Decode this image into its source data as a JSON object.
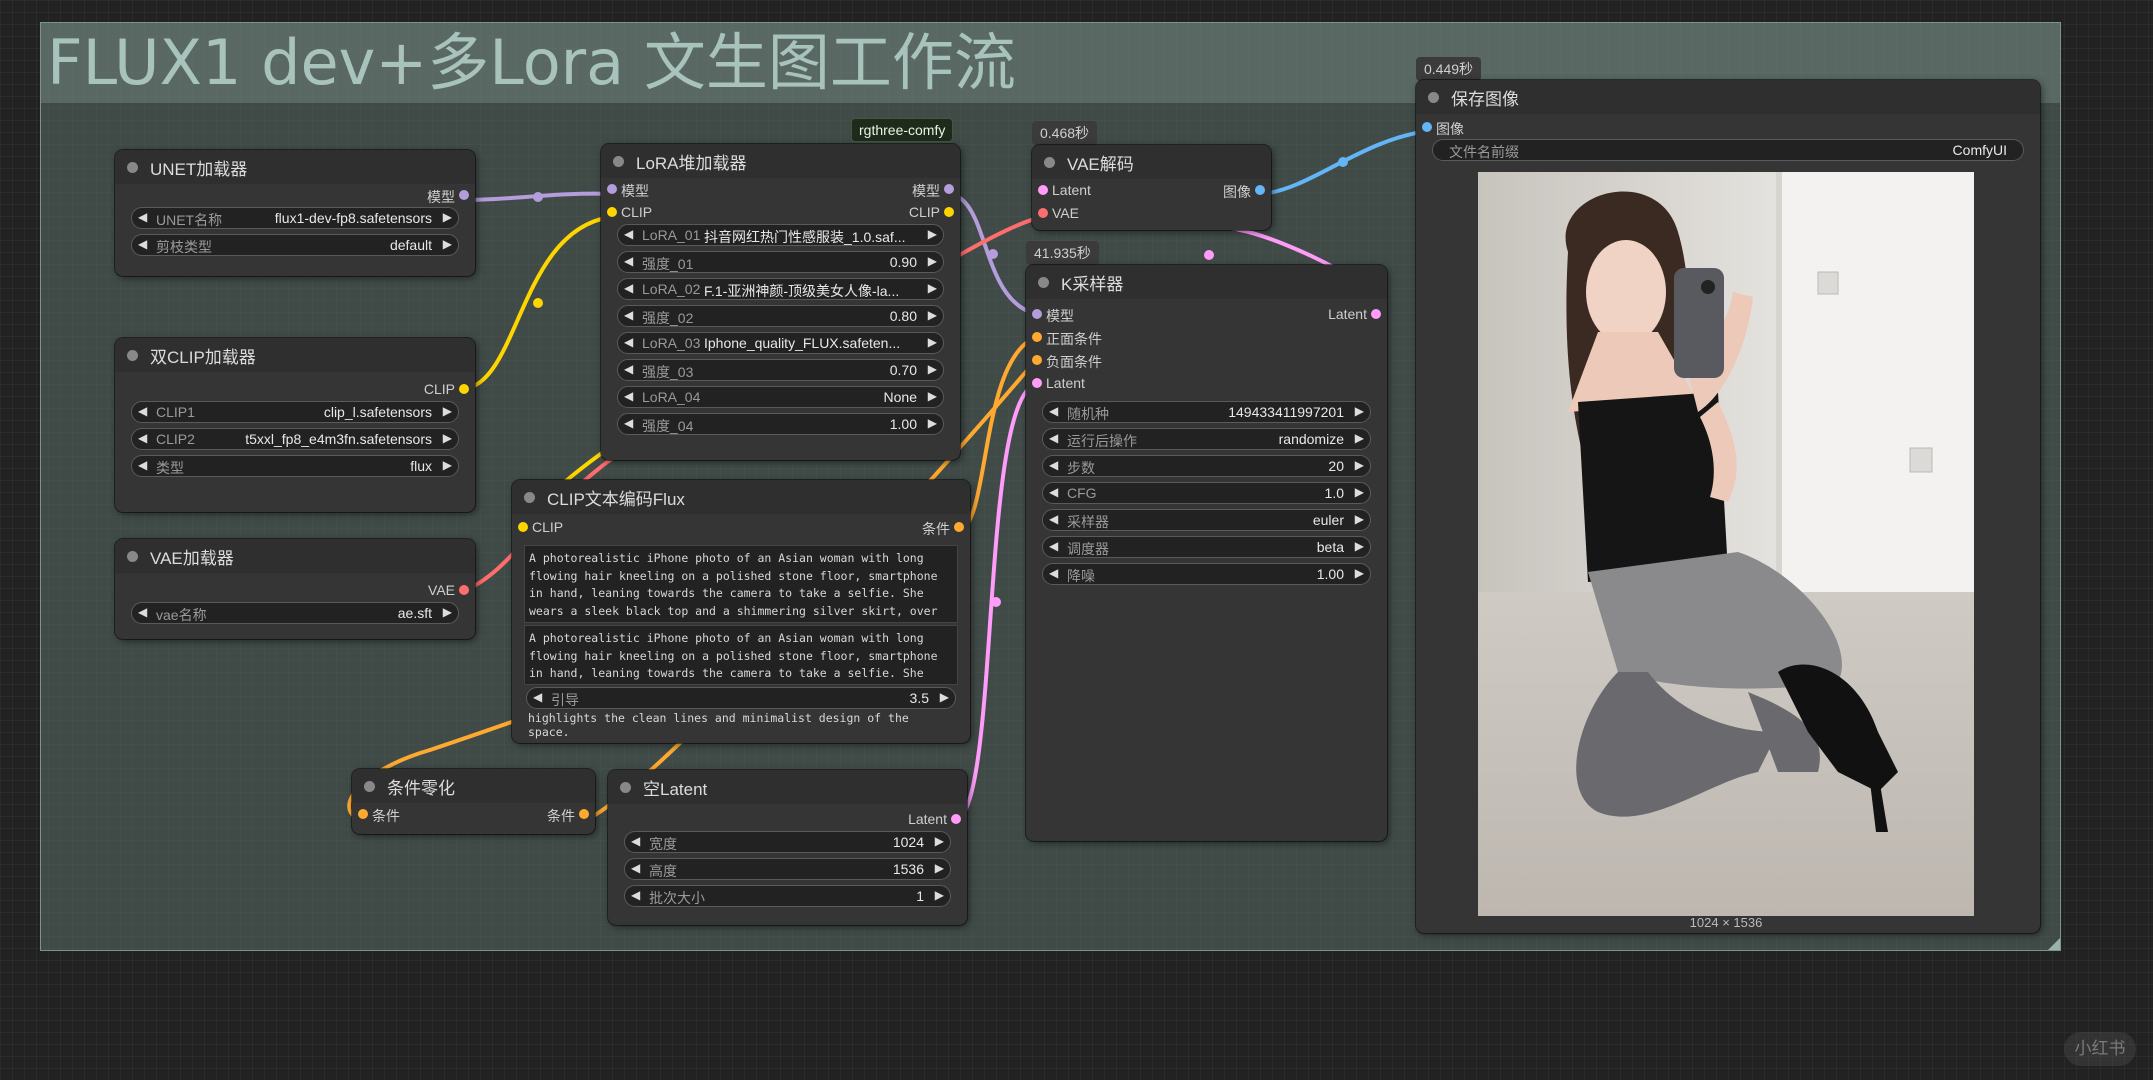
{
  "group": {
    "title": "FLUX1 dev+多Lora 文生图工作流"
  },
  "badge": "rgthree-comfy",
  "nodes": {
    "unet": {
      "title": "UNET加载器",
      "out": "模型",
      "widgets": [
        {
          "label": "UNET名称",
          "value": "flux1-dev-fp8.safetensors"
        },
        {
          "label": "剪枝类型",
          "value": "default"
        }
      ]
    },
    "dualclip": {
      "title": "双CLIP加载器",
      "out": "CLIP",
      "widgets": [
        {
          "label": "CLIP1",
          "value": "clip_l.safetensors"
        },
        {
          "label": "CLIP2",
          "value": "t5xxl_fp8_e4m3fn.safetensors"
        },
        {
          "label": "类型",
          "value": "flux"
        }
      ]
    },
    "vaeload": {
      "title": "VAE加载器",
      "out": "VAE",
      "widgets": [
        {
          "label": "vae名称",
          "value": "ae.sft"
        }
      ]
    },
    "lora": {
      "title": "LoRA堆加载器",
      "in1": "模型",
      "out1": "模型",
      "in2": "CLIP",
      "out2": "CLIP",
      "widgets": [
        {
          "label": "LoRA_01",
          "value": "抖音网红热门性感服装_1.0.saf..."
        },
        {
          "label": "强度_01",
          "value": "0.90"
        },
        {
          "label": "LoRA_02",
          "value": "F.1-亚洲神颜-顶级美女人像-la..."
        },
        {
          "label": "强度_02",
          "value": "0.80"
        },
        {
          "label": "LoRA_03",
          "value": "Iphone_quality_FLUX.safeten..."
        },
        {
          "label": "强度_03",
          "value": "0.70"
        },
        {
          "label": "LoRA_04",
          "value": "None"
        },
        {
          "label": "强度_04",
          "value": "1.00"
        }
      ]
    },
    "clipenc": {
      "title": "CLIP文本编码Flux",
      "in1": "CLIP",
      "out1": "条件",
      "text1": "A photorealistic iPhone photo of an Asian woman with long flowing hair kneeling on a polished stone floor, smartphone in hand, leaning towards the camera to take a selfie. She wears a sleek black top and a shimmering silver skirt, over which sheer over-the-knee grey stockings and elegant black high heels shine. The room's soft, diffused natural light",
      "text2": "A photorealistic iPhone photo of an Asian woman with long flowing hair kneeling on a polished stone floor, smartphone in hand, leaning towards the camera to take a selfie. She wears a sleek black top and a shimmering silver skirt, over which sheer over-the-knee grey stockings and elegant",
      "guide": {
        "label": "引导",
        "value": "3.5"
      },
      "tail": "highlights the clean lines and minimalist design of the space."
    },
    "condzero": {
      "title": "条件零化",
      "in1": "条件",
      "out1": "条件"
    },
    "emptylatent": {
      "title": "空Latent",
      "out1": "Latent",
      "widgets": [
        {
          "label": "宽度",
          "value": "1024"
        },
        {
          "label": "高度",
          "value": "1536"
        },
        {
          "label": "批次大小",
          "value": "1"
        }
      ]
    },
    "vaedecode": {
      "title": "VAE解码",
      "timer": "0.468秒",
      "in1": "Latent",
      "out1": "图像",
      "in2": "VAE"
    },
    "ksampler": {
      "title": "K采样器",
      "timer": "41.935秒",
      "in1": "模型",
      "out1": "Latent",
      "in2": "正面条件",
      "in3": "负面条件",
      "in4": "Latent",
      "widgets": [
        {
          "label": "随机种",
          "value": "149433411997201"
        },
        {
          "label": "运行后操作",
          "value": "randomize"
        },
        {
          "label": "步数",
          "value": "20"
        },
        {
          "label": "CFG",
          "value": "1.0"
        },
        {
          "label": "采样器",
          "value": "euler"
        },
        {
          "label": "调度器",
          "value": "beta"
        },
        {
          "label": "降噪",
          "value": "1.00"
        }
      ]
    },
    "save": {
      "title": "保存图像",
      "timer": "0.449秒",
      "in1": "图像",
      "widgets": [
        {
          "label": "文件名前缀",
          "value": "ComfyUI"
        }
      ],
      "image_size": "1024 × 1536"
    }
  },
  "colors": {
    "model": "#b39ddb",
    "clip": "#ffd500",
    "vae": "#ff6e6e",
    "latent": "#ff9cf9",
    "conditioning": "#ffa931",
    "image": "#64b5f6"
  },
  "watermark": "小红书"
}
